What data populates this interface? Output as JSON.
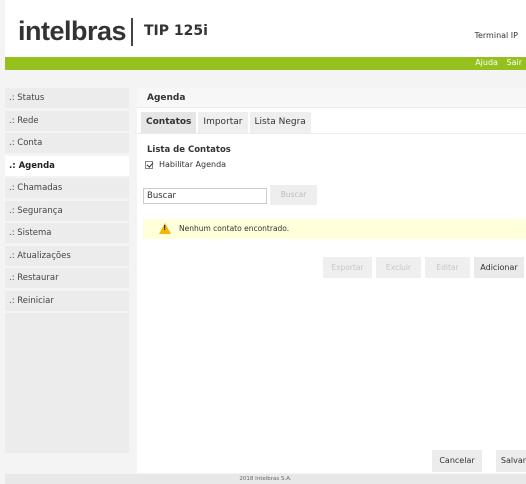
{
  "header": {
    "brand": "intelbras",
    "model": "TIP 125i",
    "device_label": "Terminal IP"
  },
  "topbar": {
    "help": "Ajuda",
    "logout": "Sair",
    "color": "#95c11f"
  },
  "sidebar": {
    "items": [
      {
        "label": ".: Status"
      },
      {
        "label": ".: Rede"
      },
      {
        "label": ".: Conta"
      },
      {
        "label": ".: Agenda"
      },
      {
        "label": ".: Chamadas"
      },
      {
        "label": ".: Segurança"
      },
      {
        "label": ".: Sistema"
      },
      {
        "label": ".: Atualizações"
      },
      {
        "label": ".: Restaurar"
      },
      {
        "label": ".: Reiniciar"
      }
    ],
    "active_index": 3
  },
  "main": {
    "title": "Agenda",
    "tabs": [
      {
        "label": "Contatos"
      },
      {
        "label": "Importar"
      },
      {
        "label": "Lista Negra"
      }
    ],
    "section_title": "Lista de Contatos",
    "enable_checkbox": {
      "label": "Habilitar Agenda",
      "checked": true
    },
    "search": {
      "value": "Buscar",
      "button": "Buscar"
    },
    "alert": {
      "text": "Nenhum contato encontrado.",
      "icon": "warning-icon",
      "color": "#ffffd9"
    },
    "actions": {
      "export": "Exportar",
      "delete": "Excluir",
      "edit": "Editar",
      "add": "Adicionar"
    },
    "cancel": "Cancelar",
    "save": "Salvar"
  },
  "footer": {
    "text": "2018 Intelbras S.A."
  }
}
